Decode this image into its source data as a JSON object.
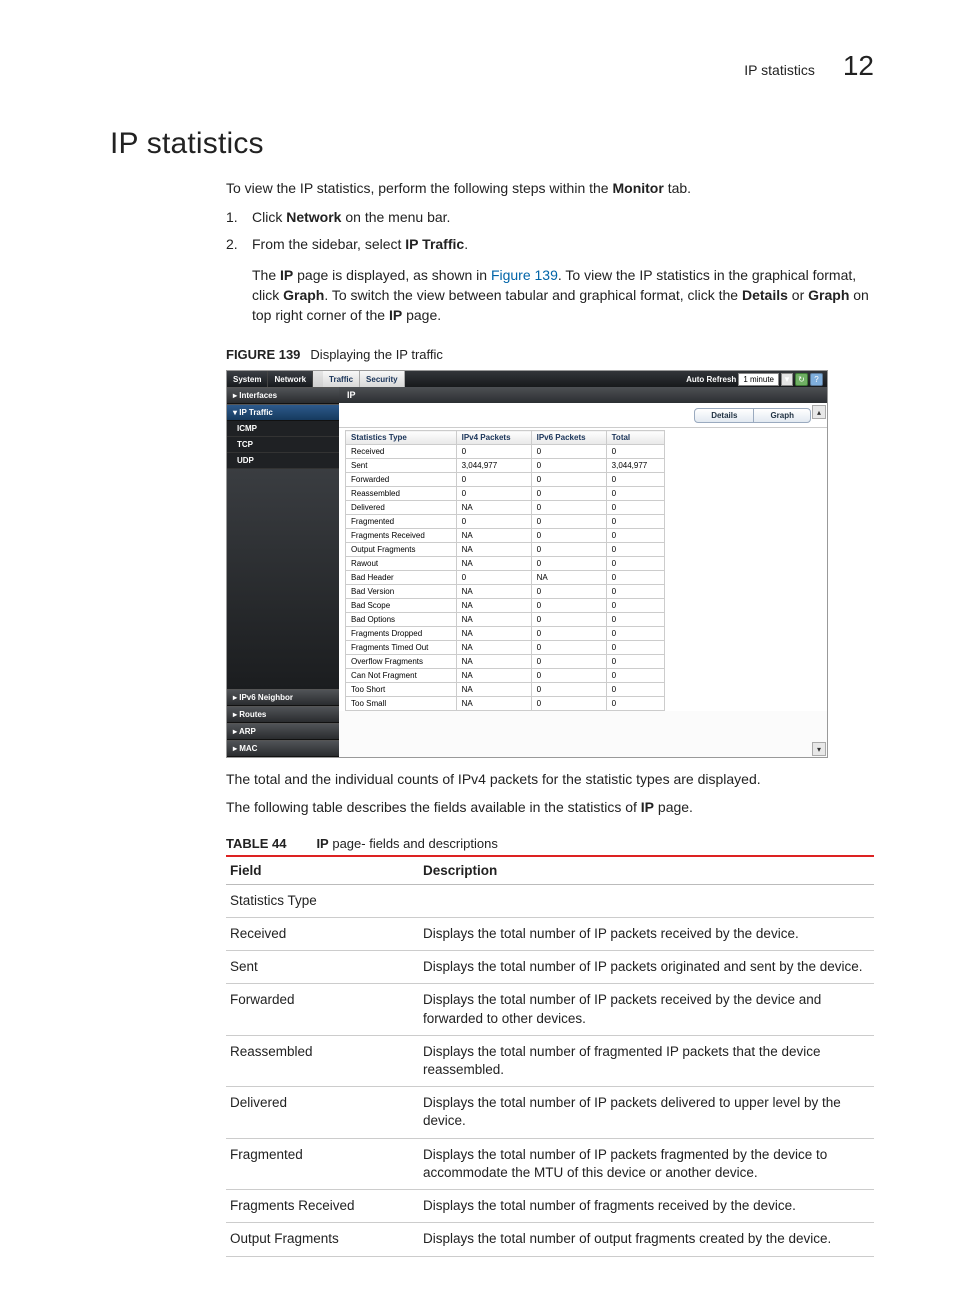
{
  "header": {
    "section": "IP statistics",
    "chapter": "12"
  },
  "title": "IP statistics",
  "intro": {
    "before": "To view the IP statistics, perform the following steps within the ",
    "bold": "Monitor",
    "after": " tab."
  },
  "steps": [
    {
      "num": "1.",
      "parts": [
        {
          "text": "Click ",
          "bold": false
        },
        {
          "text": "Network",
          "bold": true
        },
        {
          "text": " on the menu bar.",
          "bold": false
        }
      ]
    },
    {
      "num": "2.",
      "parts": [
        {
          "text": "From the sidebar, select ",
          "bold": false
        },
        {
          "text": "IP Traffic",
          "bold": true
        },
        {
          "text": ".",
          "bold": false
        }
      ]
    }
  ],
  "step_para": {
    "segments": [
      {
        "text": "The ",
        "bold": false
      },
      {
        "text": "IP",
        "bold": true
      },
      {
        "text": " page is displayed, as shown in ",
        "bold": false
      },
      {
        "text": "Figure 139",
        "link": true
      },
      {
        "text": ". To view the IP statistics in the graphical format, click ",
        "bold": false
      },
      {
        "text": "Graph",
        "bold": true
      },
      {
        "text": ". To switch the view between tabular and graphical format, click the ",
        "bold": false
      },
      {
        "text": "Details",
        "bold": true
      },
      {
        "text": " or ",
        "bold": false
      },
      {
        "text": "Graph",
        "bold": true
      },
      {
        "text": " on top right corner of the ",
        "bold": false
      },
      {
        "text": "IP",
        "bold": true
      },
      {
        "text": " page.",
        "bold": false
      }
    ]
  },
  "figure": {
    "label": "FIGURE 139",
    "caption": "Displaying the IP traffic"
  },
  "screenshot": {
    "tabs": {
      "system": "System",
      "network": "Network",
      "traffic": "Traffic",
      "security": "Security"
    },
    "auto_refresh_label": "Auto Refresh",
    "auto_refresh_value": "1 minute",
    "sidebar": [
      {
        "label": "▸ Interfaces",
        "type": "grp"
      },
      {
        "label": "▾ IP Traffic",
        "type": "grp open"
      },
      {
        "label": "ICMP",
        "type": "sub"
      },
      {
        "label": "TCP",
        "type": "sub"
      },
      {
        "label": "UDP",
        "type": "sub"
      },
      {
        "label": "spacer",
        "type": "spacer"
      },
      {
        "label": "▸ IPv6 Neighbor",
        "type": "grp"
      },
      {
        "label": "▸ Routes",
        "type": "grp"
      },
      {
        "label": "▸ ARP",
        "type": "grp"
      },
      {
        "label": "▸ MAC",
        "type": "grp"
      }
    ],
    "page_title": "IP",
    "toggle": {
      "details": "Details",
      "graph": "Graph"
    },
    "columns": [
      "Statistics Type",
      "IPv4 Packets",
      "IPv6 Packets",
      "Total"
    ],
    "rows": [
      [
        "Received",
        "0",
        "0",
        "0"
      ],
      [
        "Sent",
        "3,044,977",
        "0",
        "3,044,977"
      ],
      [
        "Forwarded",
        "0",
        "0",
        "0"
      ],
      [
        "Reassembled",
        "0",
        "0",
        "0"
      ],
      [
        "Delivered",
        "NA",
        "0",
        "0"
      ],
      [
        "Fragmented",
        "0",
        "0",
        "0"
      ],
      [
        "Fragments Received",
        "NA",
        "0",
        "0"
      ],
      [
        "Output Fragments",
        "NA",
        "0",
        "0"
      ],
      [
        "Rawout",
        "NA",
        "0",
        "0"
      ],
      [
        "Bad Header",
        "0",
        "NA",
        "0"
      ],
      [
        "Bad Version",
        "NA",
        "0",
        "0"
      ],
      [
        "Bad Scope",
        "NA",
        "0",
        "0"
      ],
      [
        "Bad Options",
        "NA",
        "0",
        "0"
      ],
      [
        "Fragments Dropped",
        "NA",
        "0",
        "0"
      ],
      [
        "Fragments Timed Out",
        "NA",
        "0",
        "0"
      ],
      [
        "Overflow Fragments",
        "NA",
        "0",
        "0"
      ],
      [
        "Can Not Fragment",
        "NA",
        "0",
        "0"
      ],
      [
        "Too Short",
        "NA",
        "0",
        "0"
      ],
      [
        "Too Small",
        "NA",
        "0",
        "0"
      ]
    ]
  },
  "post_fig_p1": "The total and the individual counts of IPv4 packets for the statistic types are displayed.",
  "post_fig_p2": {
    "before": "The following table describes the fields available in the statistics of ",
    "bold": "IP",
    "after": " page."
  },
  "table44": {
    "label": "TABLE 44",
    "caption_before": "",
    "caption_bold": "IP",
    "caption_after": " page- fields and descriptions",
    "head": {
      "field": "Field",
      "desc": "Description"
    },
    "rows": [
      {
        "field": "Statistics Type",
        "desc": ""
      },
      {
        "field": "Received",
        "desc": "Displays the total number of IP packets received by the device."
      },
      {
        "field": "Sent",
        "desc": "Displays the total number of IP packets originated and sent by the device."
      },
      {
        "field": "Forwarded",
        "desc": "Displays the total number of IP packets received by the device and forwarded to other devices."
      },
      {
        "field": "Reassembled",
        "desc": "Displays the total number of fragmented IP packets that the device reassembled."
      },
      {
        "field": "Delivered",
        "desc": "Displays the total number of IP packets delivered to upper level by the device."
      },
      {
        "field": "Fragmented",
        "desc": "Displays the total number of IP packets fragmented by the device to accommodate the MTU of this device or another device."
      },
      {
        "field": "Fragments Received",
        "desc": "Displays the total number of fragments received by the device."
      },
      {
        "field": "Output Fragments",
        "desc": "Displays the total number of output fragments created by the device."
      }
    ]
  }
}
